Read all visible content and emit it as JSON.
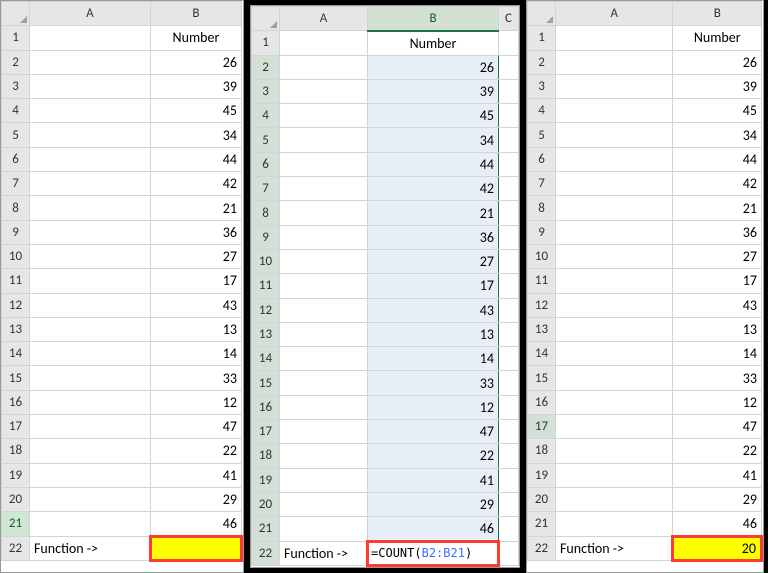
{
  "header": {
    "colA": "A",
    "colB": "B",
    "colC": "C",
    "title": "Number"
  },
  "numbers": [
    26,
    39,
    45,
    34,
    44,
    42,
    21,
    36,
    27,
    17,
    43,
    13,
    14,
    33,
    12,
    47,
    22,
    41,
    29,
    46
  ],
  "functionLabel": "Function ->",
  "formula_prefix": "=COUNT(",
  "formula_ref": "B2:B21",
  "formula_suffix": ")",
  "result": "20",
  "rows": [
    "1",
    "2",
    "3",
    "4",
    "5",
    "6",
    "7",
    "8",
    "9",
    "10",
    "11",
    "12",
    "13",
    "14",
    "15",
    "16",
    "17",
    "18",
    "19",
    "20",
    "21",
    "22"
  ]
}
